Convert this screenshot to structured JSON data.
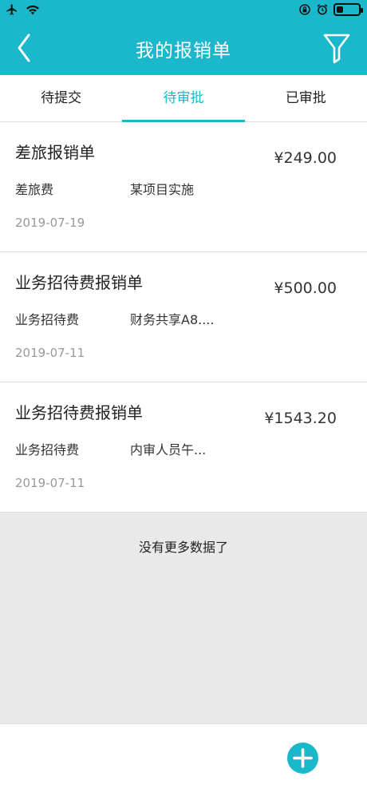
{
  "header": {
    "title": "我的报销单",
    "back_icon": "chevron-left-icon",
    "filter_icon": "filter-icon",
    "color": "#1bb7cb"
  },
  "status_bar": {
    "icons": [
      "airplane-icon",
      "wifi-icon",
      "lock-rotation-icon",
      "alarm-icon",
      "battery-icon"
    ],
    "battery_level": 0.3
  },
  "tabs": [
    {
      "label": "待提交",
      "active": false
    },
    {
      "label": "待审批",
      "active": true
    },
    {
      "label": "已审批",
      "active": false
    }
  ],
  "claims": [
    {
      "title": "差旅报销单",
      "amount": "¥249.00",
      "type": "差旅费",
      "project": "某项目实施",
      "date": "2019-07-19"
    },
    {
      "title": "业务招待费报销单",
      "amount": "¥500.00",
      "type": "业务招待费",
      "project": "财务共享A8....",
      "date": "2019-07-11"
    },
    {
      "title": "业务招待费报销单",
      "amount": "¥1543.20",
      "type": "业务招待费",
      "project": "内审人员午...",
      "date": "2019-07-11"
    }
  ],
  "footer": {
    "no_more_text": "没有更多数据了",
    "add_icon": "plus-icon"
  }
}
